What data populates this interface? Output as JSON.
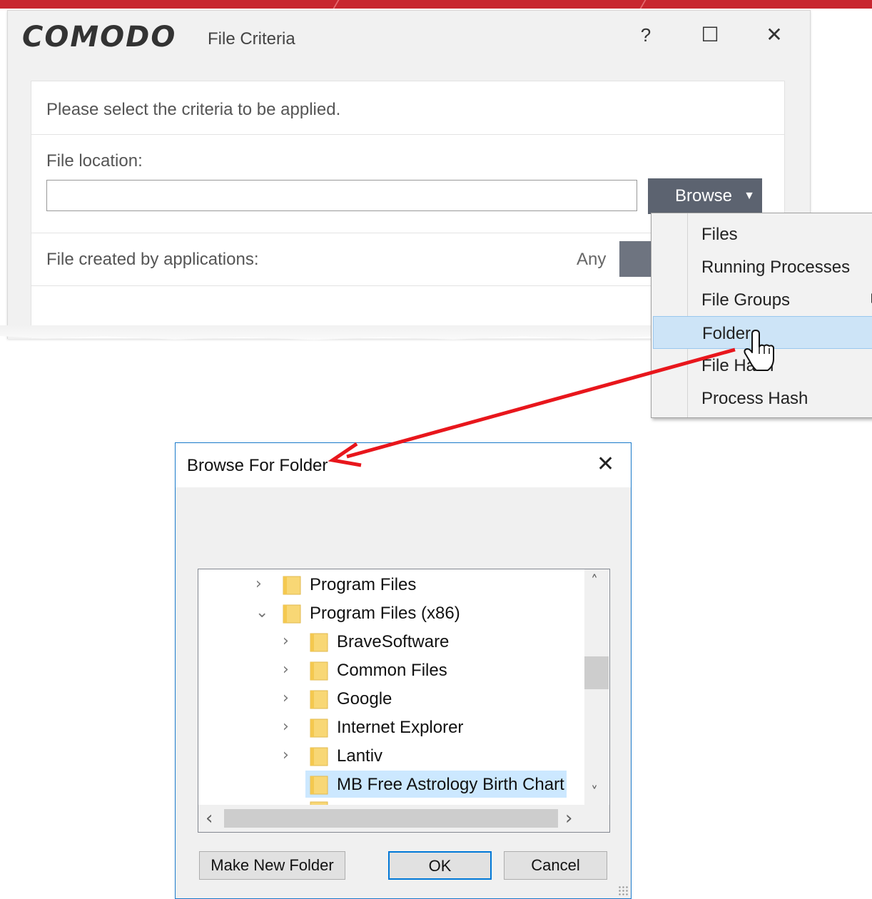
{
  "comodo_window": {
    "brand": "COMODO",
    "title": "File Criteria",
    "help": "?",
    "maximize": "☐",
    "close": "✕",
    "prompt": "Please select the criteria to be applied.",
    "file_location_label": "File location:",
    "file_location_value": "",
    "browse_label": "Browse",
    "browse_caret": "▼",
    "created_by_label": "File created by applications:",
    "created_by_value": "Any"
  },
  "browse_menu": {
    "items": [
      {
        "label": "Files"
      },
      {
        "label": "Running Processes"
      },
      {
        "label": "File Groups",
        "has_submenu": true
      },
      {
        "label": "Folder",
        "highlighted": true
      },
      {
        "label": "File Hash"
      },
      {
        "label": "Process Hash"
      }
    ]
  },
  "folder_dialog": {
    "title": "Browse For Folder",
    "close": "✕",
    "tree": [
      {
        "label": "Program Files",
        "level": 0,
        "expander": "›"
      },
      {
        "label": "Program Files (x86)",
        "level": 0,
        "expander": "⌄"
      },
      {
        "label": "BraveSoftware",
        "level": 1,
        "expander": "›"
      },
      {
        "label": "Common Files",
        "level": 1,
        "expander": "›"
      },
      {
        "label": "Google",
        "level": 1,
        "expander": "›"
      },
      {
        "label": "Internet Explorer",
        "level": 1,
        "expander": "›"
      },
      {
        "label": "Lantiv",
        "level": 1,
        "expander": "›"
      },
      {
        "label": "MB Free Astrology Birth Chart",
        "level": 1,
        "expander": "",
        "selected": true
      }
    ],
    "scroll_up": "˄",
    "scroll_down": "˅",
    "scroll_left": "‹",
    "scroll_right": "›",
    "buttons": {
      "new_folder": "Make New Folder",
      "ok": "OK",
      "cancel": "Cancel"
    }
  },
  "colors": {
    "brand_bar": "#c8262f",
    "browse_button": "#5c6370",
    "menu_highlight": "#cde4f7",
    "selection": "#cce8ff",
    "dialog_border": "#1979ca",
    "arrow": "#e8161c",
    "folder": "#f8d775"
  }
}
